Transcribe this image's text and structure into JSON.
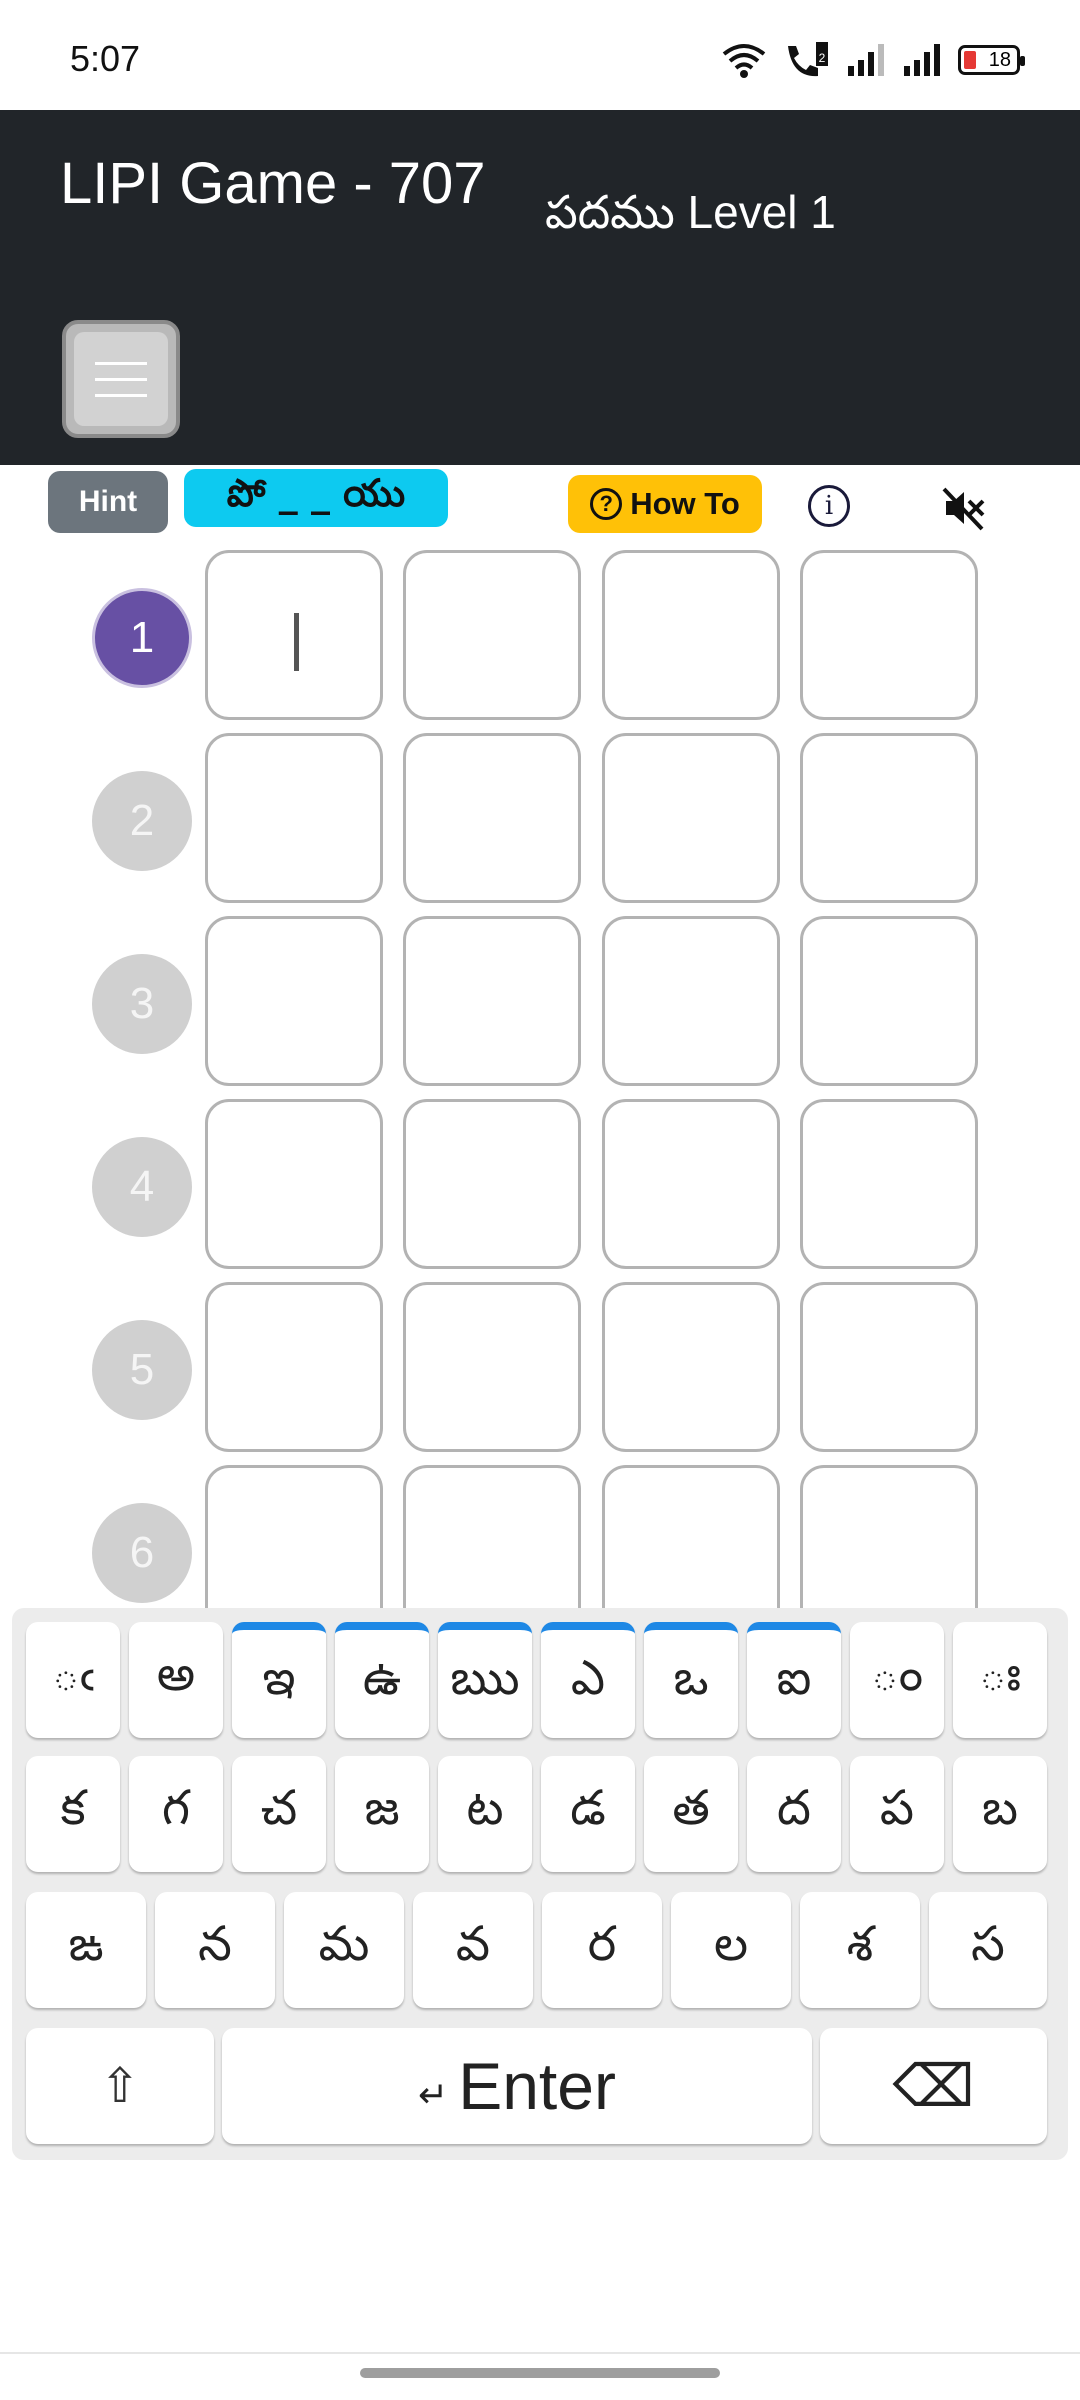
{
  "status_bar": {
    "time": "5:07",
    "battery": "18"
  },
  "header": {
    "title": "LIPI Game - 707",
    "level_label": "పదము Level 1"
  },
  "toolbar": {
    "hint_label": "Hint",
    "hint_pattern": "పో _ _ యు",
    "howto_label": "How To",
    "howto_icon": "?",
    "info_icon": "i"
  },
  "rows": [
    "1",
    "2",
    "3",
    "4",
    "5",
    "6"
  ],
  "colors": {
    "header_bg": "#212529",
    "active_row": "#6750a4",
    "hint": "#0dcaf0",
    "howto": "#ffc107",
    "key_marker": "#1e88e5"
  },
  "keyboard": {
    "row1": [
      "ఁ",
      "అ",
      "ఇ",
      "ఉ",
      "ఋ",
      "ఎ",
      "ఒ",
      "ఐ",
      "◌ం",
      "◌ః"
    ],
    "row2": [
      "క",
      "గ",
      "చ",
      "జ",
      "ట",
      "డ",
      "త",
      "ద",
      "ప",
      "బ"
    ],
    "row3": [
      "ఙ",
      "న",
      "మ",
      "వ",
      "ర",
      "ల",
      "శ",
      "స"
    ],
    "shift": "⇧",
    "enter_arrow": "↵",
    "enter": "Enter",
    "backspace": "⌫"
  }
}
